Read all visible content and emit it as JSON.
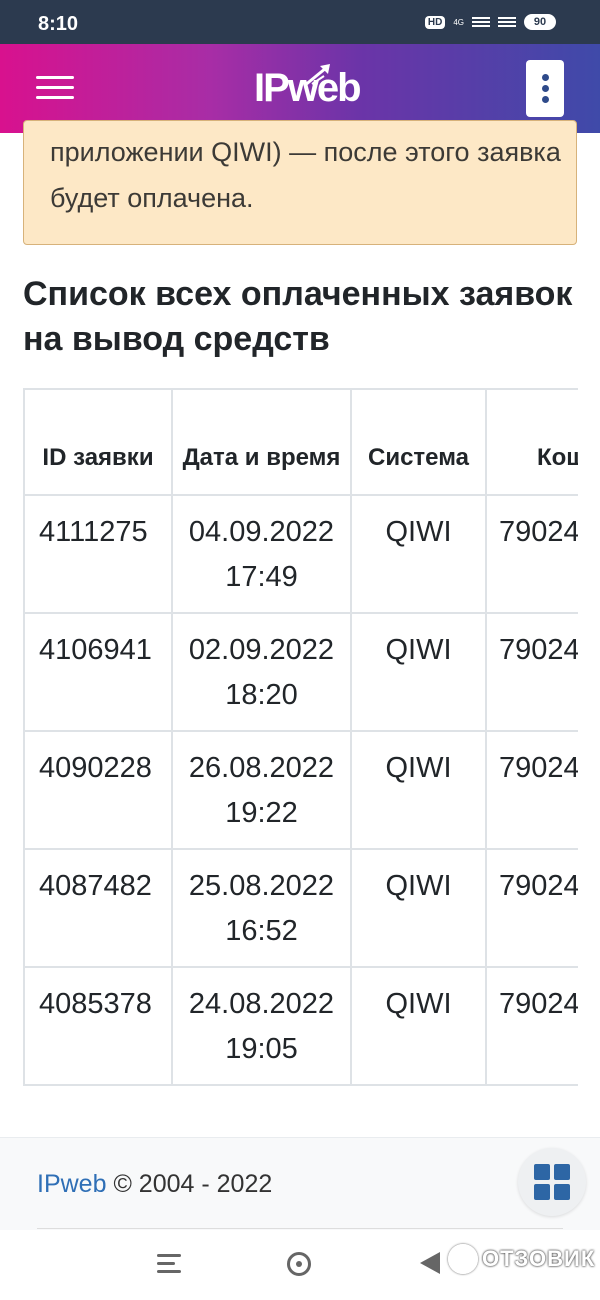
{
  "status_bar": {
    "time": "8:10",
    "hd": "HD",
    "network": "4G",
    "battery": "90"
  },
  "navbar": {
    "logo_text": "IPweb"
  },
  "alert": {
    "text": "приложении QIWI) — после этого заявка будет оплачена."
  },
  "section": {
    "title": "Список всех оплаченных заявок на вывод средств"
  },
  "table": {
    "headers": {
      "id": "ID заявки",
      "date": "Дата и время",
      "system": "Система",
      "wallet": "Кошелек"
    },
    "rows": [
      {
        "id": "4111275",
        "date": "04.09.2022",
        "time": "17:49",
        "system": "QIWI",
        "wallet": "79024"
      },
      {
        "id": "4106941",
        "date": "02.09.2022",
        "time": "18:20",
        "system": "QIWI",
        "wallet": "79024"
      },
      {
        "id": "4090228",
        "date": "26.08.2022",
        "time": "19:22",
        "system": "QIWI",
        "wallet": "79024"
      },
      {
        "id": "4087482",
        "date": "25.08.2022",
        "time": "16:52",
        "system": "QIWI",
        "wallet": "79024"
      },
      {
        "id": "4085378",
        "date": "24.08.2022",
        "time": "19:05",
        "system": "QIWI",
        "wallet": "79024"
      }
    ]
  },
  "footer": {
    "link": "IPweb",
    "copyright": "© 2004 - 2022"
  },
  "watermark": {
    "text": "ОТЗОВИК"
  },
  "colors": {
    "accent": "#2f6fb6",
    "alert_bg": "#fde8c6",
    "grid_icon": "#2d66a5"
  }
}
